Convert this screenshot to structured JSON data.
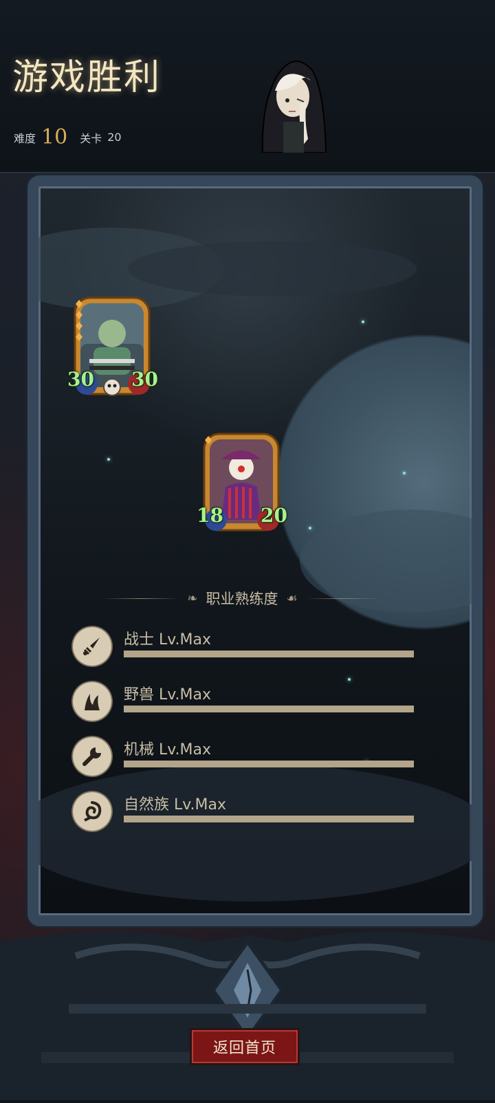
{
  "header": {
    "title": "游戏胜利",
    "difficulty_label": "难度",
    "difficulty_value": "10",
    "stage_label": "关卡",
    "stage_value": "20"
  },
  "cards": [
    {
      "name": "thug",
      "attack": "30",
      "health": "30"
    },
    {
      "name": "clown",
      "attack": "18",
      "health": "20"
    }
  ],
  "mastery": {
    "title": "职业熟练度",
    "items": [
      {
        "label": "战士 Lv.Max",
        "icon": "sword-icon",
        "progress": 1.0
      },
      {
        "label": "野兽 Lv.Max",
        "icon": "claw-icon",
        "progress": 1.0
      },
      {
        "label": "机械 Lv.Max",
        "icon": "wrench-icon",
        "progress": 1.0
      },
      {
        "label": "自然族 Lv.Max",
        "icon": "swirl-icon",
        "progress": 1.0
      }
    ]
  },
  "button": {
    "home": "返回首页"
  },
  "colors": {
    "title": "#f3e6c2",
    "accent_gold": "#d8ad5b",
    "button_red": "#7c1616",
    "stat_green": "#a6f28e"
  }
}
